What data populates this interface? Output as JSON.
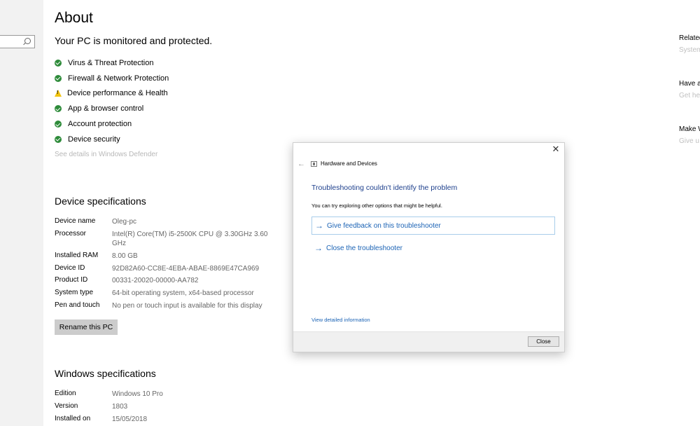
{
  "page": {
    "title": "About",
    "status_heading": "Your PC is monitored and protected."
  },
  "protection": {
    "items": [
      {
        "label": "Virus & Threat Protection",
        "status": "ok",
        "icon": "check-circle-icon"
      },
      {
        "label": "Firewall & Network Protection",
        "status": "ok",
        "icon": "check-circle-icon"
      },
      {
        "label": "Device performance & Health",
        "status": "warning",
        "icon": "warning-icon"
      },
      {
        "label": "App & browser control",
        "status": "ok",
        "icon": "check-circle-icon"
      },
      {
        "label": "Account protection",
        "status": "ok",
        "icon": "check-circle-icon"
      },
      {
        "label": "Device security",
        "status": "ok",
        "icon": "check-circle-icon"
      }
    ],
    "details_link": "See details in Windows Defender"
  },
  "device_specs": {
    "heading": "Device specifications",
    "rows": [
      {
        "label": "Device name",
        "value": "Oleg-pc"
      },
      {
        "label": "Processor",
        "value": "Intel(R) Core(TM) i5-2500K CPU @ 3.30GHz   3.60 GHz"
      },
      {
        "label": "Installed RAM",
        "value": "8.00 GB"
      },
      {
        "label": "Device ID",
        "value": "92D82A60-CC8E-4EBA-ABAE-8869E47CA969"
      },
      {
        "label": "Product ID",
        "value": "00331-20020-00000-AA782"
      },
      {
        "label": "System type",
        "value": "64-bit operating system, x64-based processor"
      },
      {
        "label": "Pen and touch",
        "value": "No pen or touch input is available for this display"
      }
    ],
    "rename_button": "Rename this PC"
  },
  "windows_specs": {
    "heading": "Windows specifications",
    "rows": [
      {
        "label": "Edition",
        "value": "Windows 10 Pro"
      },
      {
        "label": "Version",
        "value": "1803"
      },
      {
        "label": "Installed on",
        "value": "15/05/2018"
      }
    ]
  },
  "right_panel": {
    "sections": [
      {
        "heading": "Related",
        "link": "System"
      },
      {
        "heading": "Have a",
        "link": "Get he"
      },
      {
        "heading": "Make W",
        "link": "Give u"
      }
    ]
  },
  "dialog": {
    "window_title": "Hardware and Devices",
    "headline": "Troubleshooting couldn't identify the problem",
    "description": "You can try exploring other options that might be helpful.",
    "options": [
      {
        "label": "Give feedback on this troubleshooter",
        "icon": "arrow-right-icon"
      },
      {
        "label": "Close the troubleshooter",
        "icon": "arrow-right-icon"
      }
    ],
    "detail_link": "View detailed information",
    "close_button": "Close",
    "close_glyph": "✕",
    "back_glyph": "←"
  },
  "colors": {
    "accent": "#1b63b5",
    "headline": "#1d3f8c",
    "ok": "#2e8b3a",
    "warning": "#f2c40f"
  }
}
